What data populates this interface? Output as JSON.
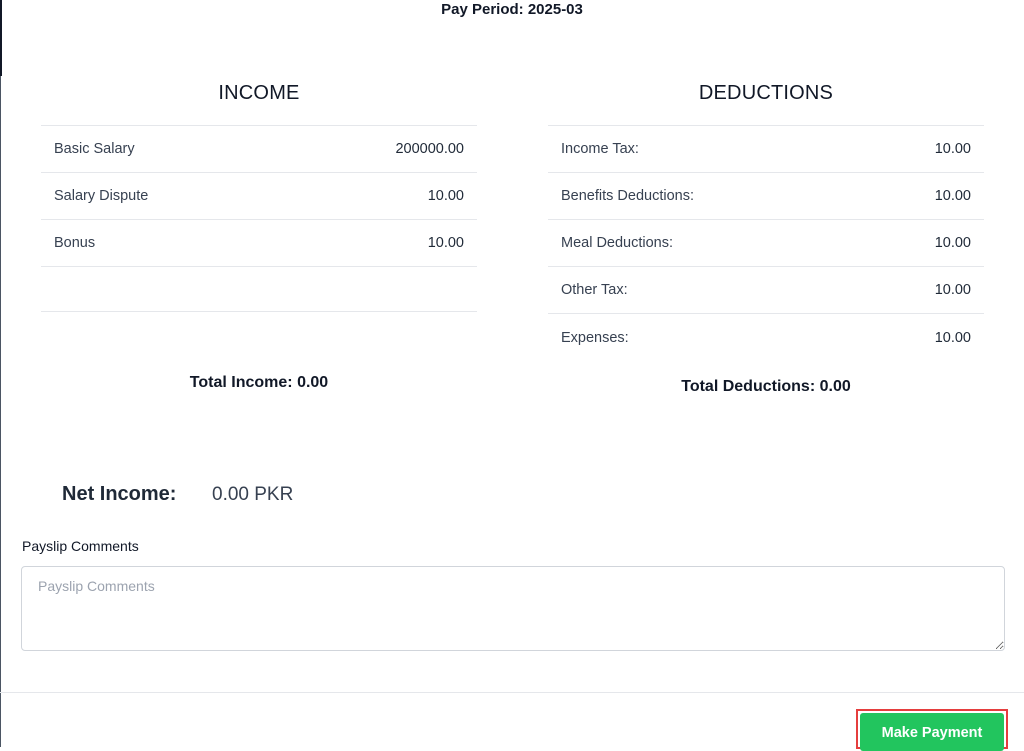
{
  "header": {
    "pay_period": "Pay Period: 2025-03"
  },
  "income": {
    "title": "INCOME",
    "items": [
      {
        "label": "Basic Salary",
        "amount": "200000.00"
      },
      {
        "label": "Salary Dispute",
        "amount": "10.00"
      },
      {
        "label": "Bonus",
        "amount": "10.00"
      }
    ],
    "total": "Total Income: 0.00"
  },
  "deductions": {
    "title": "DEDUCTIONS",
    "items": [
      {
        "label": "Income Tax:",
        "amount": "10.00"
      },
      {
        "label": "Benefits Deductions:",
        "amount": "10.00"
      },
      {
        "label": "Meal Deductions:",
        "amount": "10.00"
      },
      {
        "label": "Other Tax:",
        "amount": "10.00"
      },
      {
        "label": "Expenses:",
        "amount": "10.00"
      }
    ],
    "total": "Total Deductions: 0.00"
  },
  "net": {
    "label": "Net Income:",
    "value": "0.00 PKR"
  },
  "comments": {
    "label": "Payslip Comments",
    "placeholder": "Payslip Comments",
    "value": ""
  },
  "footer": {
    "make_payment_label": "Make Payment",
    "make_payment_color": "#22c55e",
    "highlight_color": "#e53e3e"
  }
}
